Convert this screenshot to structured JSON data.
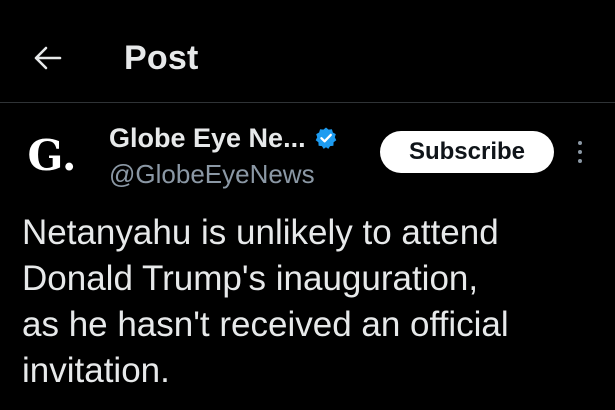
{
  "header": {
    "title": "Post",
    "back_icon": "arrow-left-icon"
  },
  "author": {
    "avatar_letter": "G.",
    "name": "Globe Eye Ne...",
    "verified_icon": "verified-badge-icon",
    "verified_color": "#1d9bf0",
    "handle": "@GlobeEyeNews"
  },
  "actions": {
    "subscribe_label": "Subscribe",
    "more_icon": "more-vertical-icon"
  },
  "post": {
    "text": "Netanyahu is unlikely to attend\nDonald Trump's inauguration,\nas he hasn't received an official\ninvitation."
  },
  "colors": {
    "background": "#000000",
    "primary_text": "#e7e9ea",
    "secondary_text": "#8b98a5",
    "divider": "#2f3336"
  }
}
